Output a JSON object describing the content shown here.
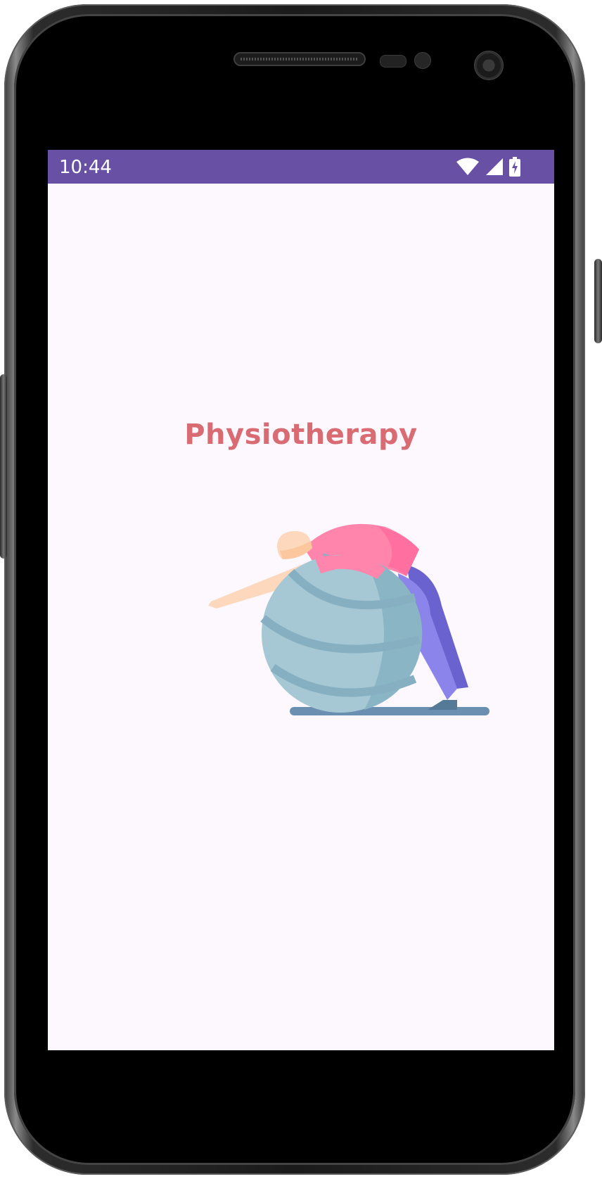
{
  "status_bar": {
    "time": "10:44",
    "icons": [
      "wifi-icon",
      "cellular-signal-icon",
      "battery-charging-icon"
    ],
    "color": "#6851a5"
  },
  "main": {
    "title": "Physiotherapy",
    "title_color": "#d96b73",
    "illustration": "person-stretching-on-exercise-ball"
  },
  "screen_background": "#fdf8fd"
}
